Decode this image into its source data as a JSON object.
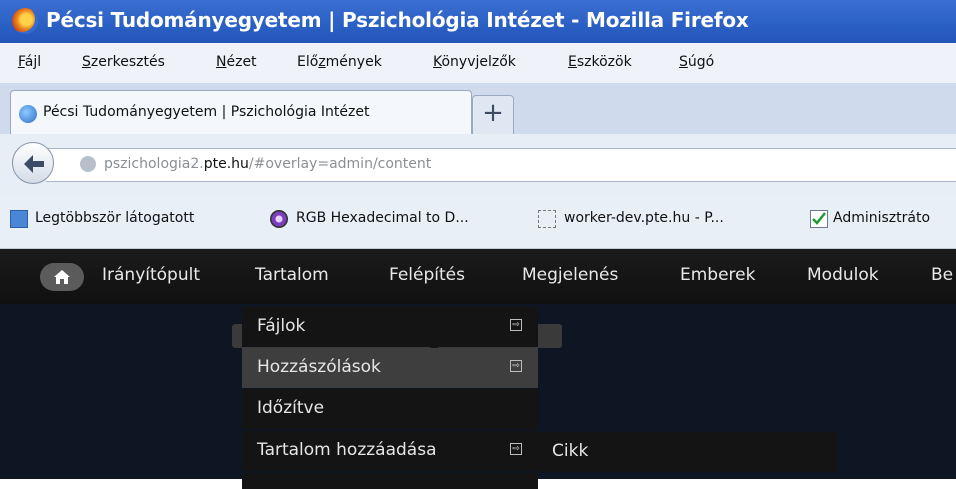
{
  "window": {
    "title": "Pécsi Tudományegyetem | Pszichológia Intézet - Mozilla Firefox"
  },
  "menubar": {
    "items": [
      {
        "pre": "",
        "ul": "F",
        "post": "ájl"
      },
      {
        "pre": "",
        "ul": "S",
        "post": "zerkesztés"
      },
      {
        "pre": "",
        "ul": "N",
        "post": "ézet"
      },
      {
        "pre": "Elő",
        "ul": "z",
        "post": "mények"
      },
      {
        "pre": "",
        "ul": "K",
        "post": "önyvjelzők"
      },
      {
        "pre": "",
        "ul": "E",
        "post": "szközök"
      },
      {
        "pre": "",
        "ul": "S",
        "post": "úgó"
      }
    ]
  },
  "tabs": {
    "active_label": "Pécsi Tudományegyetem | Pszichológia Intézet",
    "new_tab_label": "+"
  },
  "navbar": {
    "url_prefix": "pszichologia2.",
    "url_domain": "pte.hu",
    "url_suffix": "/#overlay=admin/content"
  },
  "bookmarks": [
    {
      "label": "Legtöbbször látogatott",
      "icon": "bookmarks-folder-icon"
    },
    {
      "label": "RGB Hexadecimal to D...",
      "icon": "rgb-site-icon"
    },
    {
      "label": "worker-dev.pte.hu - P...",
      "icon": "dashed-page-icon"
    },
    {
      "label": "Adminisztráto",
      "icon": "checkbox-icon"
    }
  ],
  "admin_toolbar": {
    "items": [
      "Irányítópult",
      "Tartalom",
      "Felépítés",
      "Megjelenés",
      "Emberek",
      "Modulok",
      "Be"
    ]
  },
  "dropdown": {
    "items": [
      {
        "label": "Fájlok",
        "arrow": "⇨"
      },
      {
        "label": "Hozzászólások",
        "arrow": "⇨"
      },
      {
        "label": "Időzítve",
        "arrow": ""
      },
      {
        "label": "Tartalom hozzáadása",
        "arrow": "⇨"
      }
    ],
    "submenu": {
      "label": "Cikk"
    }
  }
}
